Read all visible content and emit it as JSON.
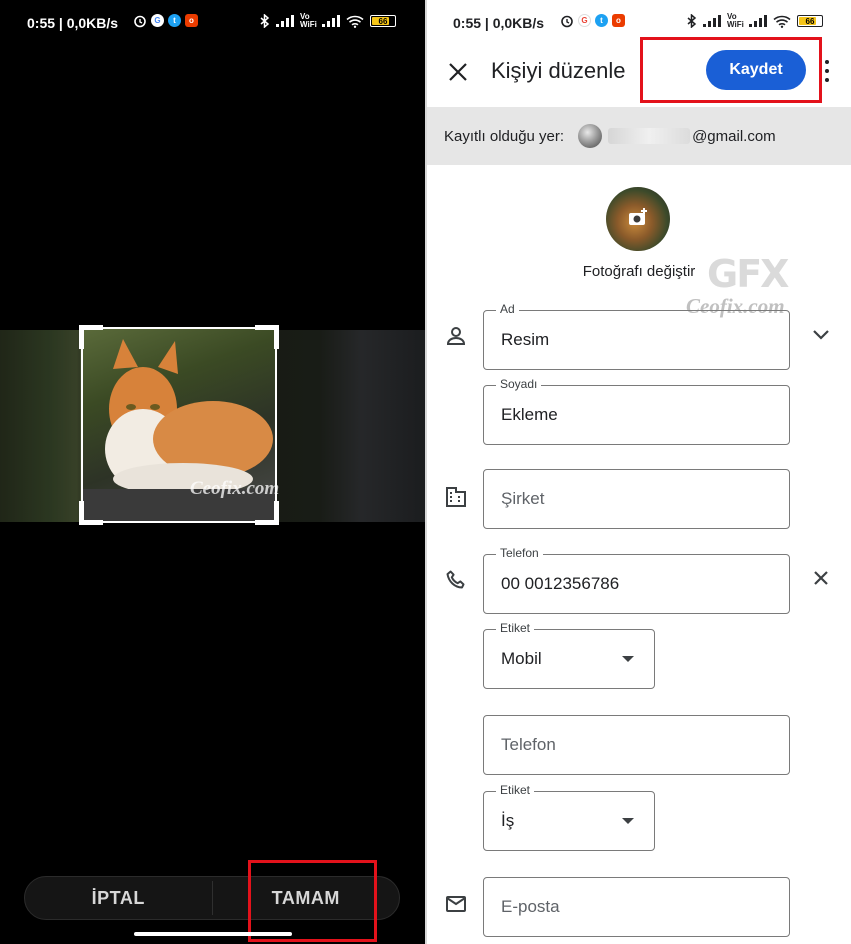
{
  "status_bar": {
    "time_left": "0:55 | 0,0KB/s",
    "time_right": "0:55 | 0,0KB/s",
    "vowifi_label": "Vo WiFi",
    "battery_level": "66"
  },
  "crop_screen": {
    "watermark": "Ceofix.com",
    "cancel_label": "İPTAL",
    "ok_label": "TAMAM"
  },
  "edit_contact": {
    "title": "Kişiyi düzenle",
    "save_label": "Kaydet",
    "account": {
      "label": "Kayıtlı olduğu yer:",
      "email_suffix": "@gmail.com"
    },
    "photo_label": "Fotoğrafı değiştir",
    "watermark_gfx": "GFX",
    "watermark": "Ceofix.com",
    "fields": {
      "first_name": {
        "label": "Ad",
        "value": "Resim"
      },
      "last_name": {
        "label": "Soyadı",
        "value": "Ekleme"
      },
      "company": {
        "placeholder": "Şirket"
      },
      "phone": {
        "label": "Telefon",
        "value": "00 0012356786"
      },
      "phone_label": {
        "label": "Etiket",
        "value": "Mobil"
      },
      "phone2": {
        "placeholder": "Telefon"
      },
      "phone2_label": {
        "label": "Etiket",
        "value": "İş"
      },
      "email": {
        "placeholder": "E-posta"
      }
    }
  },
  "colors": {
    "accent_blue": "#1a5fd6",
    "highlight_red": "#e3121b",
    "account_bar_bg": "#e6e6e6"
  },
  "icons": [
    "close-icon",
    "more-vert-icon",
    "add-photo-icon",
    "person-icon",
    "expand-icon",
    "business-icon",
    "phone-icon",
    "remove-icon",
    "email-icon",
    "dropdown-arrow-icon"
  ]
}
